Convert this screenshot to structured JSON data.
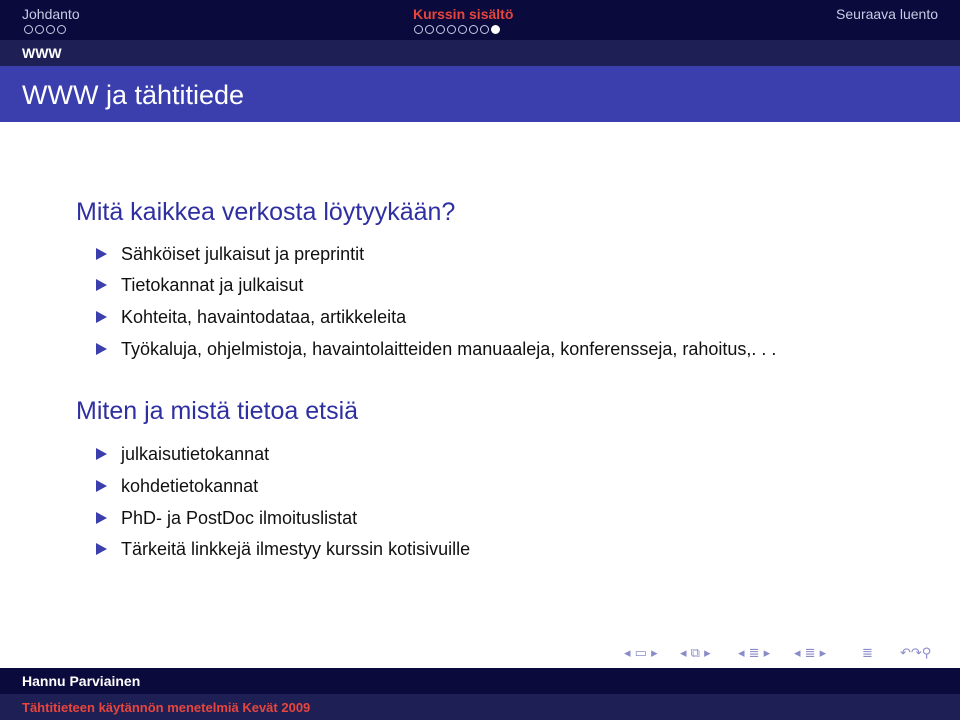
{
  "header": {
    "sections": [
      {
        "label": "Johdanto",
        "dots": 4,
        "current_dot": null
      },
      {
        "label": "Kurssin sisältö",
        "dots": 8,
        "current_dot": 7
      },
      {
        "label": "Seuraava luento"
      }
    ],
    "active_section": "Kurssin sisältö",
    "subsection": "WWW"
  },
  "frame": {
    "title": "WWW ja tähtitiede"
  },
  "blocks": [
    {
      "title": "Mitä kaikkea verkosta löytyykään?",
      "items": [
        "Sähköiset julkaisut ja preprintit",
        "Tietokannat ja julkaisut",
        "Kohteita, havaintodataa, artikkeleita",
        "Työkaluja, ohjelmistoja, havaintolaitteiden manuaaleja, konferensseja, rahoitus,. . ."
      ]
    },
    {
      "title": "Miten ja mistä tietoa etsiä",
      "items": [
        "julkaisutietokannat",
        "kohdetietokannat",
        "PhD- ja PostDoc ilmoituslistat",
        "Tärkeitä linkkejä ilmestyy kurssin kotisivuille"
      ]
    }
  ],
  "nav_symbols": [
    "slide-nav",
    "frame-nav",
    "subsection-nav",
    "section-nav",
    "document-nav",
    "search-zoom"
  ],
  "footer": {
    "author": "Hannu Parviainen",
    "course": "Tähtitieteen käytännön menetelmiä Kevät 2009"
  },
  "colors": {
    "header_bg": "#0a0a3c",
    "title_bg": "#3b3fae",
    "accent_red": "#e8453c",
    "block_title": "#2e2fa0"
  }
}
